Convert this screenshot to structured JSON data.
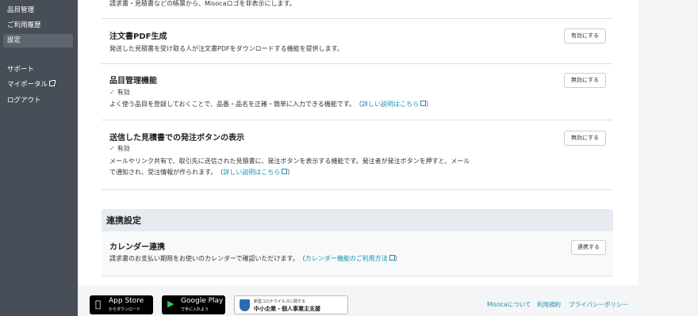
{
  "sidebar": {
    "items": [
      {
        "label": "品目管理"
      },
      {
        "label": "ご利用履歴"
      },
      {
        "label": "設定"
      },
      {
        "label": "サポート"
      },
      {
        "label": "マイポータル"
      },
      {
        "label": "ログアウト"
      }
    ]
  },
  "settings": {
    "logo_desc": "請求書・見積書などの帳票から、Misocaロゴを非表示にします。",
    "po_pdf": {
      "title": "注文書PDF生成",
      "desc": "発送した見積書を受け取る人が注文書PDFをダウンロードする機能を提供します。",
      "button": "有効にする"
    },
    "item_mgmt": {
      "title": "品目管理機能",
      "status": "有効",
      "desc": "よく使う品目を登録しておくことで、品番・品名を正確・簡単に入力できる機能です。",
      "link": "詳しい説明はこちら",
      "button": "無効にする"
    },
    "order_button": {
      "title": "送信した見積書での発注ボタンの表示",
      "status": "有効",
      "desc_line1": "メールやリンク共有で、取引先に送信された見積書に、発注ボタンを表示する機能です。発注者が発注ボタンを押すと、メール",
      "desc_line2": "で通知され、受注情報が作られます。",
      "link": "詳しい説明はこちら",
      "button": "無効にする"
    }
  },
  "integration": {
    "section_title": "連携設定",
    "calendar": {
      "title": "カレンダー連携",
      "desc": "請求書のお支払い期限をお使いのカレンダーで確認いただけます。",
      "link": "カレンダー機能のご利用方法",
      "button": "連携する"
    }
  },
  "footer": {
    "app_store": {
      "big": "App Store",
      "small": "からダウンロード"
    },
    "google_play": {
      "big": "Google Play",
      "small": "で手に入れよう"
    },
    "covid": {
      "line1": "新型コロナウイルスに関する",
      "line2": "中小企業・個人事業主支援"
    },
    "links": [
      "Misocaについて",
      "利用規約",
      "プライバシーポリシー"
    ]
  }
}
